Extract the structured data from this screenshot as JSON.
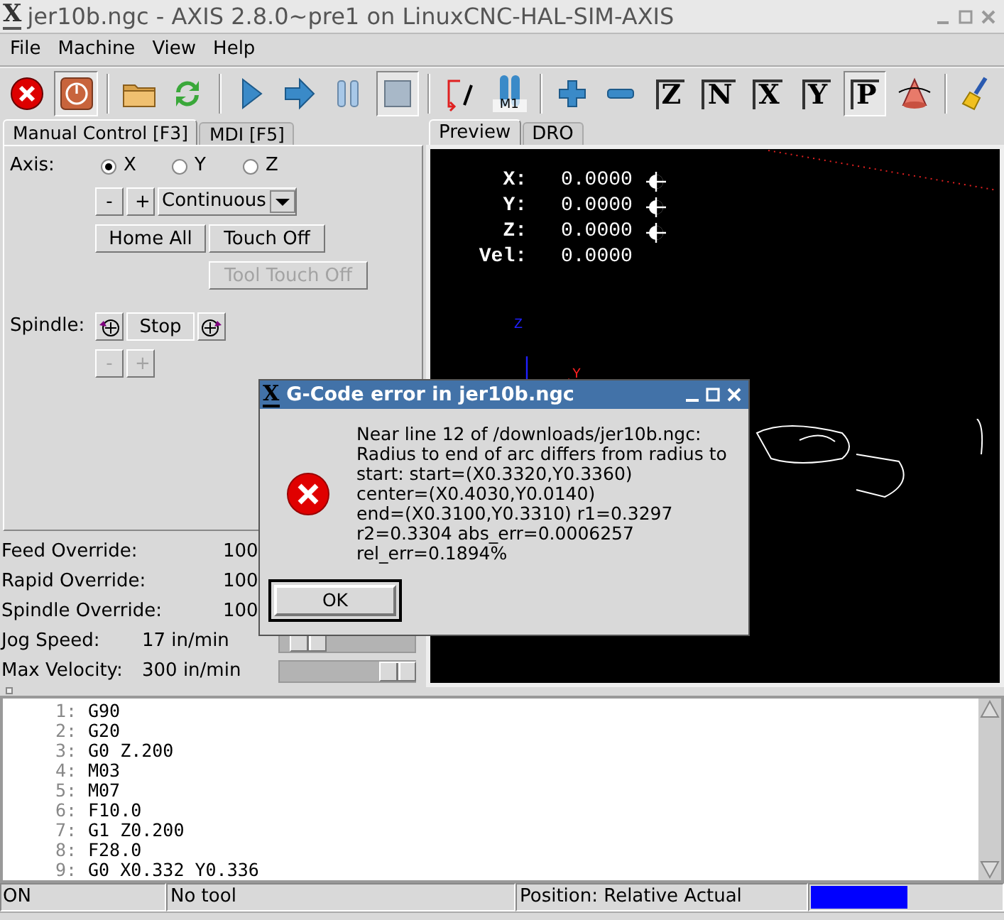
{
  "window": {
    "icon": "X",
    "title": "jer10b.ngc - AXIS 2.8.0~pre1 on LinuxCNC-HAL-SIM-AXIS"
  },
  "menu": [
    "File",
    "Machine",
    "View",
    "Help"
  ],
  "toolbar": [
    {
      "kind": "estop",
      "pressed": false
    },
    {
      "kind": "power",
      "pressed": true
    },
    {
      "kind": "separator"
    },
    {
      "kind": "open",
      "pressed": false
    },
    {
      "kind": "reload",
      "pressed": false
    },
    {
      "kind": "separator"
    },
    {
      "kind": "run",
      "pressed": false
    },
    {
      "kind": "step",
      "pressed": false
    },
    {
      "kind": "pause",
      "pressed": false
    },
    {
      "kind": "stop",
      "pressed": true
    },
    {
      "kind": "separator"
    },
    {
      "kind": "blockdelete",
      "pressed": false
    },
    {
      "kind": "optstop",
      "label": "M1",
      "pressed": false
    },
    {
      "kind": "separator"
    },
    {
      "kind": "zoomin",
      "pressed": false
    },
    {
      "kind": "zoomout",
      "pressed": false
    },
    {
      "kind": "view",
      "label": "Z",
      "pressed": false
    },
    {
      "kind": "view",
      "label": "N",
      "pressed": false
    },
    {
      "kind": "view",
      "label": "X",
      "pressed": false
    },
    {
      "kind": "view",
      "label": "Y",
      "pressed": false
    },
    {
      "kind": "view",
      "label": "P",
      "pressed": true
    },
    {
      "kind": "rotate",
      "pressed": false
    },
    {
      "kind": "separator"
    },
    {
      "kind": "clear",
      "pressed": false
    }
  ],
  "left_tabs": [
    {
      "label": "Manual Control [F3]",
      "selected": true
    },
    {
      "label": "MDI [F5]",
      "selected": false
    }
  ],
  "manual": {
    "axis_label": "Axis:",
    "axes": [
      {
        "label": "X",
        "selected": true
      },
      {
        "label": "Y",
        "selected": false
      },
      {
        "label": "Z",
        "selected": false
      }
    ],
    "jog_minus": "-",
    "jog_plus": "+",
    "increment": "Continuous",
    "buttons": [
      {
        "label": "Home All",
        "disabled": false
      },
      {
        "label": "Touch Off",
        "disabled": false
      },
      {
        "label": "Tool Touch Off",
        "disabled": true
      }
    ],
    "spindle_label": "Spindle:",
    "spindle_stop": "Stop",
    "spindle_minus": {
      "label": "-",
      "disabled": true
    },
    "spindle_plus": {
      "label": "+",
      "disabled": true
    }
  },
  "overrides": [
    {
      "kind": "value",
      "label": "Feed Override:",
      "value": "100"
    },
    {
      "kind": "value",
      "label": "Rapid Override:",
      "value": "100"
    },
    {
      "kind": "value",
      "label": "Spindle Override:",
      "value": "100"
    },
    {
      "kind": "slider",
      "label": "Jog Speed:",
      "value": "17 in/min",
      "level": 0.21
    },
    {
      "kind": "slider",
      "label": "Max Velocity:",
      "value": "300 in/min",
      "level": 0.87
    }
  ],
  "preview_tabs": [
    {
      "label": "Preview",
      "selected": true
    },
    {
      "label": "DRO",
      "selected": false
    }
  ],
  "dro": [
    {
      "axis": "X:",
      "value": "0.0000",
      "homed": true
    },
    {
      "axis": "Y:",
      "value": "0.0000",
      "homed": true
    },
    {
      "axis": "Z:",
      "value": "0.0000",
      "homed": true
    },
    {
      "axis": "Vel:",
      "value": "0.0000",
      "homed": false
    }
  ],
  "axis_labels": [
    {
      "text": "Z",
      "color": "#2020ff"
    },
    {
      "text": "Y",
      "color": "#ff2020"
    }
  ],
  "code": [
    {
      "number": "1:",
      "text": "G90"
    },
    {
      "number": "2:",
      "text": "G20"
    },
    {
      "number": "3:",
      "text": "G0 Z.200"
    },
    {
      "number": "4:",
      "text": "M03"
    },
    {
      "number": "5:",
      "text": "M07"
    },
    {
      "number": "6:",
      "text": "F10.0"
    },
    {
      "number": "7:",
      "text": "G1 Z0.200"
    },
    {
      "number": "8:",
      "text": "F28.0"
    },
    {
      "number": "9:",
      "text": "G0 X0.332 Y0.336"
    }
  ],
  "status_bar": {
    "state": "ON",
    "tool": "No tool",
    "position": "Position: Relative Actual"
  },
  "dialog": {
    "icon": "X",
    "title": "G-Code error in jer10b.ngc",
    "message": "Near line 12 of /downloads/jer10b.ngc:\nRadius to end of arc differs from radius to\nstart: start=(X0.3320,Y0.3360)\ncenter=(X0.4030,Y0.0140)\nend=(X0.3100,Y0.3310) r1=0.3297\nr2=0.3304 abs_err=0.0006257\nrel_err=0.1894%",
    "button": "OK"
  }
}
